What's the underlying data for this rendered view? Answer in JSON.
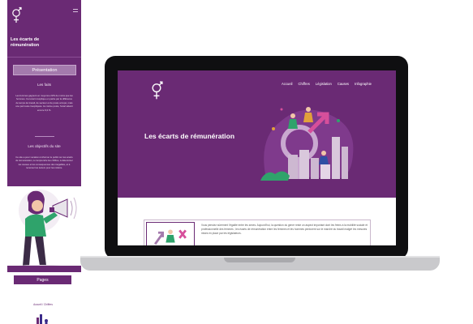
{
  "mobile": {
    "title": "Les écarts de rémunération",
    "presentation_button": "Présentation",
    "section1_heading": "Les faits",
    "section1_text": "Les femmes gagnent en moyenne 22% de moins que les hommes. Cet écart s'explique en partie par la différence de temps de travail, de secteur et de poste occupé, mais une part reste inexpliquée. Au même poste, l'écart atteint encore 9,3 %.",
    "section2_heading": "Les objectifs du site",
    "section2_text": "Ce site a pour vocation à informer le public sur les écarts de rémunération, à comprendre les chiffres, à déterminer les causes et les conséquences des inégalités, et à recenser les leviers pour les réduire.",
    "pages_button": "Pages",
    "bottom_title": "Accueil / Chiffres"
  },
  "site": {
    "nav": [
      "Accueil",
      "Chiffres",
      "Législation",
      "Causes",
      "Infographie"
    ],
    "hero_title": "Les écarts de rémunération",
    "card_text": "Vous pensiez sûrement l'égalité entre les sexes. Aujourd'hui, la question du genre reste un aspect important dont les freins à la mobilité sociale et professionnelle des femmes ; les écarts de rémunération entre les femmes et les hommes perdurent sur le marché du travail malgré les mesures mises en place par les législateurs."
  },
  "colors": {
    "brand_purple": "#6a2a74",
    "accent_lilac": "#a47aad",
    "accent_pink": "#d64f9b",
    "accent_green": "#2fa36b"
  }
}
